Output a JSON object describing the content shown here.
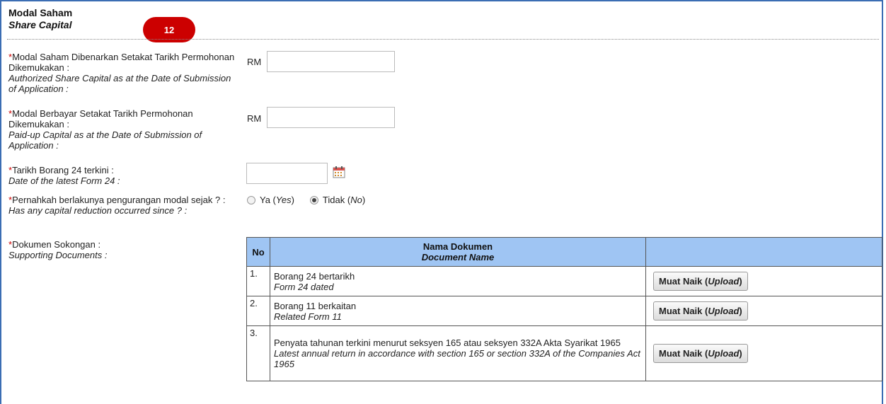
{
  "section": {
    "title_ms": "Modal Saham",
    "title_en": "Share Capital",
    "step_badge": "12"
  },
  "fields": {
    "authorized": {
      "required": "*",
      "label_ms": "Modal Saham Dibenarkan Setakat Tarikh Permohonan Dikemukakan :",
      "label_en": "Authorized Share Capital as at the Date of Submission of Application :",
      "prefix": "RM",
      "value": ""
    },
    "paidup": {
      "required": "*",
      "label_ms": "Modal Berbayar Setakat Tarikh Permohonan Dikemukakan :",
      "label_en": "Paid-up Capital as at the Date of Submission of Application :",
      "prefix": "RM",
      "value": ""
    },
    "form24_date": {
      "required": "*",
      "label_ms": "Tarikh Borang 24 terkini :",
      "label_en": "Date of the latest Form 24 :",
      "value": "",
      "icon": "calendar-icon"
    },
    "capital_reduction": {
      "required": "*",
      "label_ms": "Pernahkah berlakunya pengurangan modal sejak ? :",
      "label_en": "Has any capital reduction occurred since ? :",
      "options": [
        {
          "ms": "Ya",
          "en": "Yes",
          "checked": false
        },
        {
          "ms": "Tidak",
          "en": "No",
          "checked": true
        }
      ]
    },
    "supporting_docs": {
      "required": "*",
      "label_ms": "Dokumen Sokongan :",
      "label_en": "Supporting Documents :"
    }
  },
  "docs_table": {
    "headers": {
      "no": "No",
      "name_ms": "Nama Dokumen",
      "name_en": "Document Name"
    },
    "upload_ms": "Muat Naik",
    "upload_en": "Upload",
    "rows": [
      {
        "no": "1.",
        "name_ms": "Borang 24 bertarikh",
        "name_en": "Form 24 dated"
      },
      {
        "no": "2.",
        "name_ms": "Borang 11 berkaitan",
        "name_en": "Related Form 11"
      },
      {
        "no": "3.",
        "name_ms": "Penyata tahunan terkini menurut seksyen 165 atau seksyen 332A Akta Syarikat 1965",
        "name_en": "Latest annual return in accordance with section 165 or section 332A of the Companies Act 1965"
      }
    ]
  }
}
